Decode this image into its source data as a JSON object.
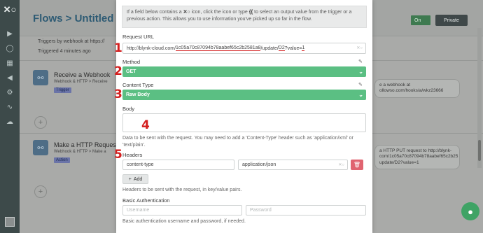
{
  "sidebar": {
    "logo": "✕○",
    "items": [
      "▶",
      "◯",
      "▦",
      "◀",
      "⚙",
      "∿",
      "☁"
    ]
  },
  "background": {
    "title": "Flows > Untitled F",
    "triggered_by": "Triggers by webhook at https://",
    "triggered_at": "Triggered 4 minutes ago",
    "toggle_label": "On",
    "private_label": "Private",
    "steps": [
      {
        "title": "Receive a Webhook",
        "desc": "Webhook & HTTP > Receive",
        "badge": "Trigger"
      },
      {
        "title": "Make a HTTP Request",
        "desc": "Webhook & HTTP > Make a",
        "badge": "Action"
      }
    ],
    "bubble1": "e a webhook at\nollowso.com/hooks/a/wkz23666",
    "bubble2": "a HTTP PUT request to http://blynk-\ncom/1c05a70c87094b78aabef65c2b25\nupdate/D2?value=1"
  },
  "modal": {
    "info_pre": "If a field below contains a",
    "info_glyph": "✕○",
    "info_mid": "icon, click the icon or type",
    "info_brace": "{{",
    "info_post": "to select an output value from the trigger or a previous action. This allows you to use information you've picked up so far in the flow.",
    "url_label": "Request URL",
    "url_prefix": "http://blynk-cloud.com/",
    "url_token": "1c05a70c87094b78aabef65c2b2581a8",
    "url_mid": "/update/",
    "url_pin": "D2",
    "url_q": "?value=",
    "url_val": "1",
    "method_label": "Method",
    "method_value": "GET",
    "content_type_label": "Content Type",
    "content_type_value": "Raw Body",
    "body_label": "Body",
    "body_help": "Data to be sent with the request. You may need to add a 'Content-Type' header such as 'application/xml' or 'text/plain'.",
    "headers_label": "Headers",
    "header_key": "content-type",
    "header_value": "application/json",
    "add_label": "Add",
    "headers_help": "Headers to be sent with the request, in key/value pairs.",
    "auth_label": "Basic Authentication",
    "username_placeholder": "Username",
    "password_placeholder": "Password",
    "auth_help": "Basic authentication username and password, if needed."
  },
  "annotations": [
    "1",
    "2",
    "3",
    "4",
    "5"
  ],
  "colors": {
    "accent_green": "#5bbf83",
    "danger_red": "#e06470",
    "annotation_red": "#d41e1e",
    "sidebar_dark": "#3d4a4a"
  }
}
